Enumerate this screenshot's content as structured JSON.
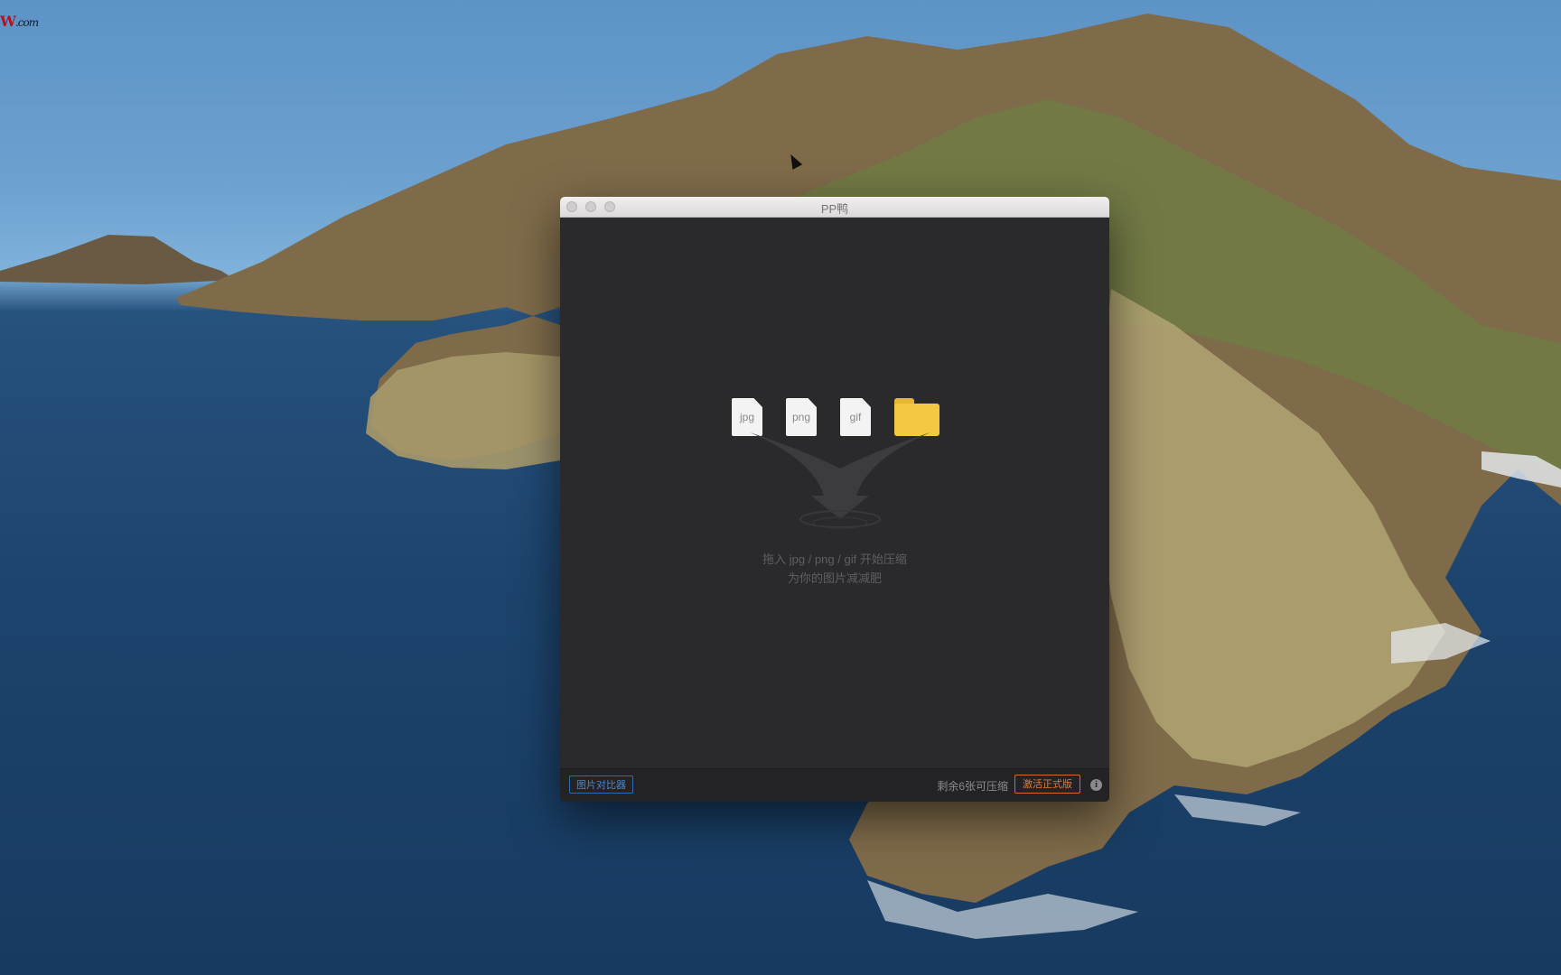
{
  "desktop": {
    "watermark_main": "W",
    "watermark_suffix": ".com"
  },
  "window": {
    "title": "PP鸭",
    "file_types": [
      "jpg",
      "png",
      "gif"
    ],
    "hint_line1": "拖入 jpg / png / gif 开始压缩",
    "hint_line2": "为你的图片减减肥"
  },
  "statusbar": {
    "compare_button": "图片对比器",
    "remaining_text": "剩余6张可压缩",
    "activate_button": "激活正式版",
    "info_icon_glyph": "i"
  },
  "colors": {
    "window_bg": "#2a2a2c",
    "compare_accent": "#2c6bb5",
    "activate_accent": "#d86a2c",
    "folder": "#f5c844"
  }
}
